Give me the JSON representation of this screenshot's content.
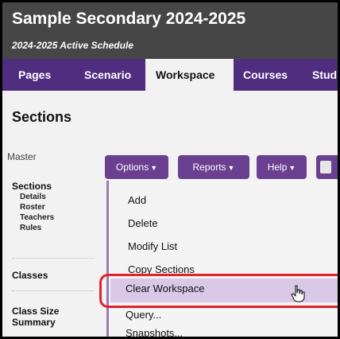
{
  "header": {
    "title": "Sample Secondary 2024-2025",
    "subtitle": "2024-2025 Active Schedule"
  },
  "nav": {
    "tabs": [
      "Pages",
      "Scenario",
      "Workspace",
      "Courses",
      "Stud"
    ],
    "active": "Workspace"
  },
  "page": {
    "title": "Sections"
  },
  "sidebar": {
    "master_label": "Master",
    "sections_heading": "Sections",
    "sections_items": [
      "Details",
      "Roster",
      "Teachers",
      "Rules"
    ],
    "classes_heading": "Classes",
    "class_size_heading_line1": "Class Size",
    "class_size_heading_line2": "Summary"
  },
  "toolbar": {
    "options_label": "Options",
    "reports_label": "Reports",
    "help_label": "Help"
  },
  "menu": {
    "items": [
      "Add",
      "Delete",
      "Modify List",
      "Copy Sections",
      "Clear Workspace",
      "Query...",
      "Snapshots..."
    ],
    "highlighted": "Clear Workspace"
  },
  "colors": {
    "header_bg": "#464646",
    "nav_bg": "#4f2d7f",
    "button_bg": "#6a3f8f",
    "highlight_bg": "#d9c8e6",
    "annotation_red": "#e2232a"
  },
  "icons": {
    "cursor": "hand-pointer-icon",
    "dropdown": "caret-down-icon"
  }
}
